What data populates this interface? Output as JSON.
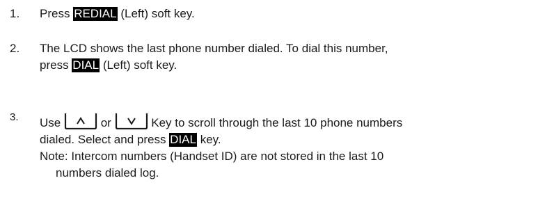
{
  "steps": [
    {
      "number": "1.",
      "before": "Press ",
      "softkey": "REDIAL",
      "after": " (Left) soft key."
    },
    {
      "number": "2.",
      "line1": "The LCD shows the last phone number dialed.  To dial this number,",
      "before": "press ",
      "softkey": "DIAL",
      "after": " (Left) soft key."
    },
    {
      "number": "3.",
      "use": "Use ",
      "or": " or ",
      "scroll_text": " Key to scroll through the last 10 phone numbers",
      "line2_before": "dialed.  Select and press ",
      "softkey": "DIAL",
      "line2_after": "  key.",
      "note_line1": "Note: Intercom numbers (Handset ID) are not stored in the last 10",
      "note_line2": "numbers dialed log.",
      "up_key_icon": "up-arrow-key",
      "down_key_icon": "down-arrow-key"
    }
  ]
}
